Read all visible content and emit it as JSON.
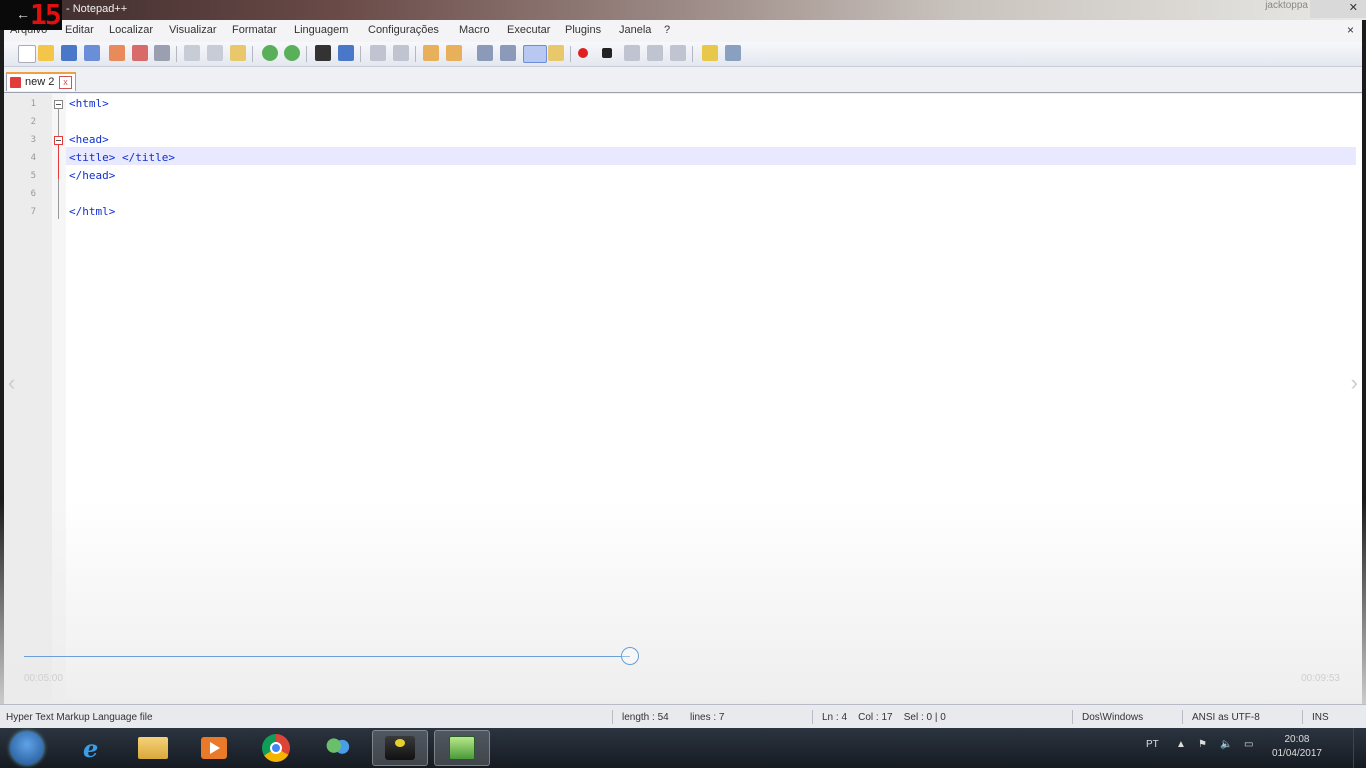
{
  "window": {
    "title": "- Notepad++",
    "overlay_counter": "15",
    "back_glyph": "←",
    "top_right_text": "jacktoppa",
    "close_glyph": "✕"
  },
  "menu": {
    "items": [
      "Arquivo",
      "Editar",
      "Localizar",
      "Visualizar",
      "Formatar",
      "Linguagem",
      "Configurações",
      "Macro",
      "Executar",
      "Plugins",
      "Janela",
      "?"
    ],
    "close_glyph": "×"
  },
  "tab": {
    "label": "new 2",
    "close_glyph": "x"
  },
  "editor": {
    "line_numbers": [
      "1",
      "2",
      "3",
      "4",
      "5",
      "6",
      "7"
    ],
    "lines": [
      "<html>",
      "",
      "<head>",
      "<title> </title>",
      "</head>",
      "",
      "</html>"
    ]
  },
  "video": {
    "elapsed": "00:05:00",
    "total": "00:09:53",
    "progress_fraction": 0.46,
    "prev_glyph": "‹",
    "next_glyph": "›"
  },
  "status": {
    "file_type": "Hyper Text Markup Language file",
    "length": "length : 54",
    "lines": "lines : 7",
    "position": "Ln : 4    Col : 17    Sel : 0 | 0",
    "eol": "Dos\\Windows",
    "encoding": "ANSI as UTF-8",
    "mode": "INS"
  },
  "taskbar": {
    "lang": "PT",
    "time": "20:08",
    "date": "01/04/2017"
  },
  "colors": {
    "tag": "#1030d0",
    "caret_line": "#e8e8ff",
    "fold_marker": "#e23b3b",
    "progress": "#6a9fd8"
  }
}
